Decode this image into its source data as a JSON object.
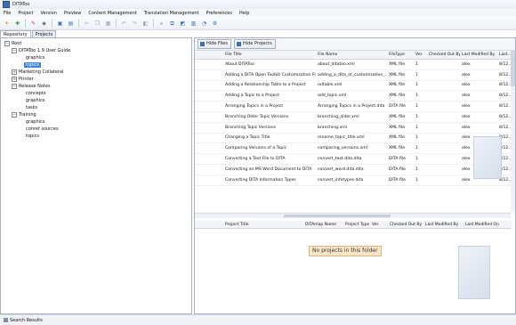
{
  "window": {
    "title": "DITAToo"
  },
  "menu": [
    "File",
    "Project",
    "Version",
    "Preview",
    "Content Management",
    "Translation Management",
    "Preferences",
    "Help"
  ],
  "toolbar": {
    "icons": [
      "new-icon",
      "add-icon",
      "check-in-icon",
      "cancel-checkout-icon",
      "open-icon",
      "save-icon",
      "cut-icon",
      "copy-icon",
      "paste-icon",
      "undo-icon",
      "redo-icon",
      "preview-icon",
      "search-icon",
      "compare-icon",
      "translate-icon",
      "publish-icon",
      "history-icon",
      "settings-icon"
    ]
  },
  "tabs": {
    "repository": "Repository",
    "projects": "Projects"
  },
  "tree": {
    "root": "Root",
    "user_guide": "DITAToo 1.9 User Guide",
    "ug_graphics": "graphics",
    "ug_topics": "topics",
    "marketing": "Marketing Collateral",
    "printer": "Printer",
    "release": "Release Notes",
    "rn_concepts": "concepts",
    "rn_graphics": "graphics",
    "rn_tasks": "tasks",
    "training": "Training",
    "tr_graphics": "graphics",
    "tr_conref": "conref sources",
    "tr_topics": "topics"
  },
  "buttons": {
    "hide_files": "Hide Files",
    "hide_projects": "Hide Projects"
  },
  "files": {
    "columns": [
      "File Title",
      "File Name",
      "FileType",
      "Ver.",
      "Checked Out By",
      "Last Modified By",
      "Last..."
    ],
    "rows": [
      [
        "About DITAToo",
        "about_ditatoo.xml",
        "XML file",
        "1",
        "",
        "alex",
        "8/12..."
      ],
      [
        "Adding a DITA Open Toolkit Customization Fo...",
        "adding_a_dita_ot_customization_...",
        "XML file",
        "1",
        "",
        "alex",
        "8/12..."
      ],
      [
        "Adding a Relationship Table to a Project",
        "reltable.xml",
        "XML file",
        "1",
        "",
        "alex",
        "8/12..."
      ],
      [
        "Adding a Topic to a Project",
        "add_topic.xml",
        "XML file",
        "1",
        "",
        "alex",
        "8/12..."
      ],
      [
        "Arranging Topics in a Project",
        "Arranging Topics in a Project.dita",
        "DITA file",
        "1",
        "",
        "alex",
        "8/12..."
      ],
      [
        "Branching Older Topic Versions",
        "branching_older.xml",
        "XML file",
        "1",
        "",
        "alex",
        "8/12..."
      ],
      [
        "Branching Topic Versions",
        "branching.xml",
        "XML file",
        "1",
        "",
        "alex",
        "8/12..."
      ],
      [
        "Changing a Topic Title",
        "rename_topic_title.xml",
        "XML file",
        "1",
        "",
        "alex",
        "8/12..."
      ],
      [
        "Comparing Versions of a Topic",
        "comparing_versions.xml",
        "XML file",
        "1",
        "",
        "alex",
        "8/12..."
      ],
      [
        "Converting a Text File to DITA",
        "convert_text.dita.dita",
        "DITA file",
        "1",
        "",
        "alex",
        "8/12..."
      ],
      [
        "Converting an MS Word Document to DITA",
        "convert_word.dita.dita",
        "DITA file",
        "1",
        "",
        "alex",
        "8/12..."
      ],
      [
        "Converting DITA Information Types",
        "convert_infotypes.dita",
        "DITA file",
        "1",
        "",
        "alex",
        "8/12..."
      ]
    ]
  },
  "projects": {
    "columns": [
      "Project Title",
      "DITAmap Name",
      "Project Type",
      "Ver.",
      "Checked Out By",
      "Last Modified By",
      "Last Modified On"
    ],
    "empty": "No projects in this folder"
  },
  "status": {
    "search_results": "Search Results"
  }
}
